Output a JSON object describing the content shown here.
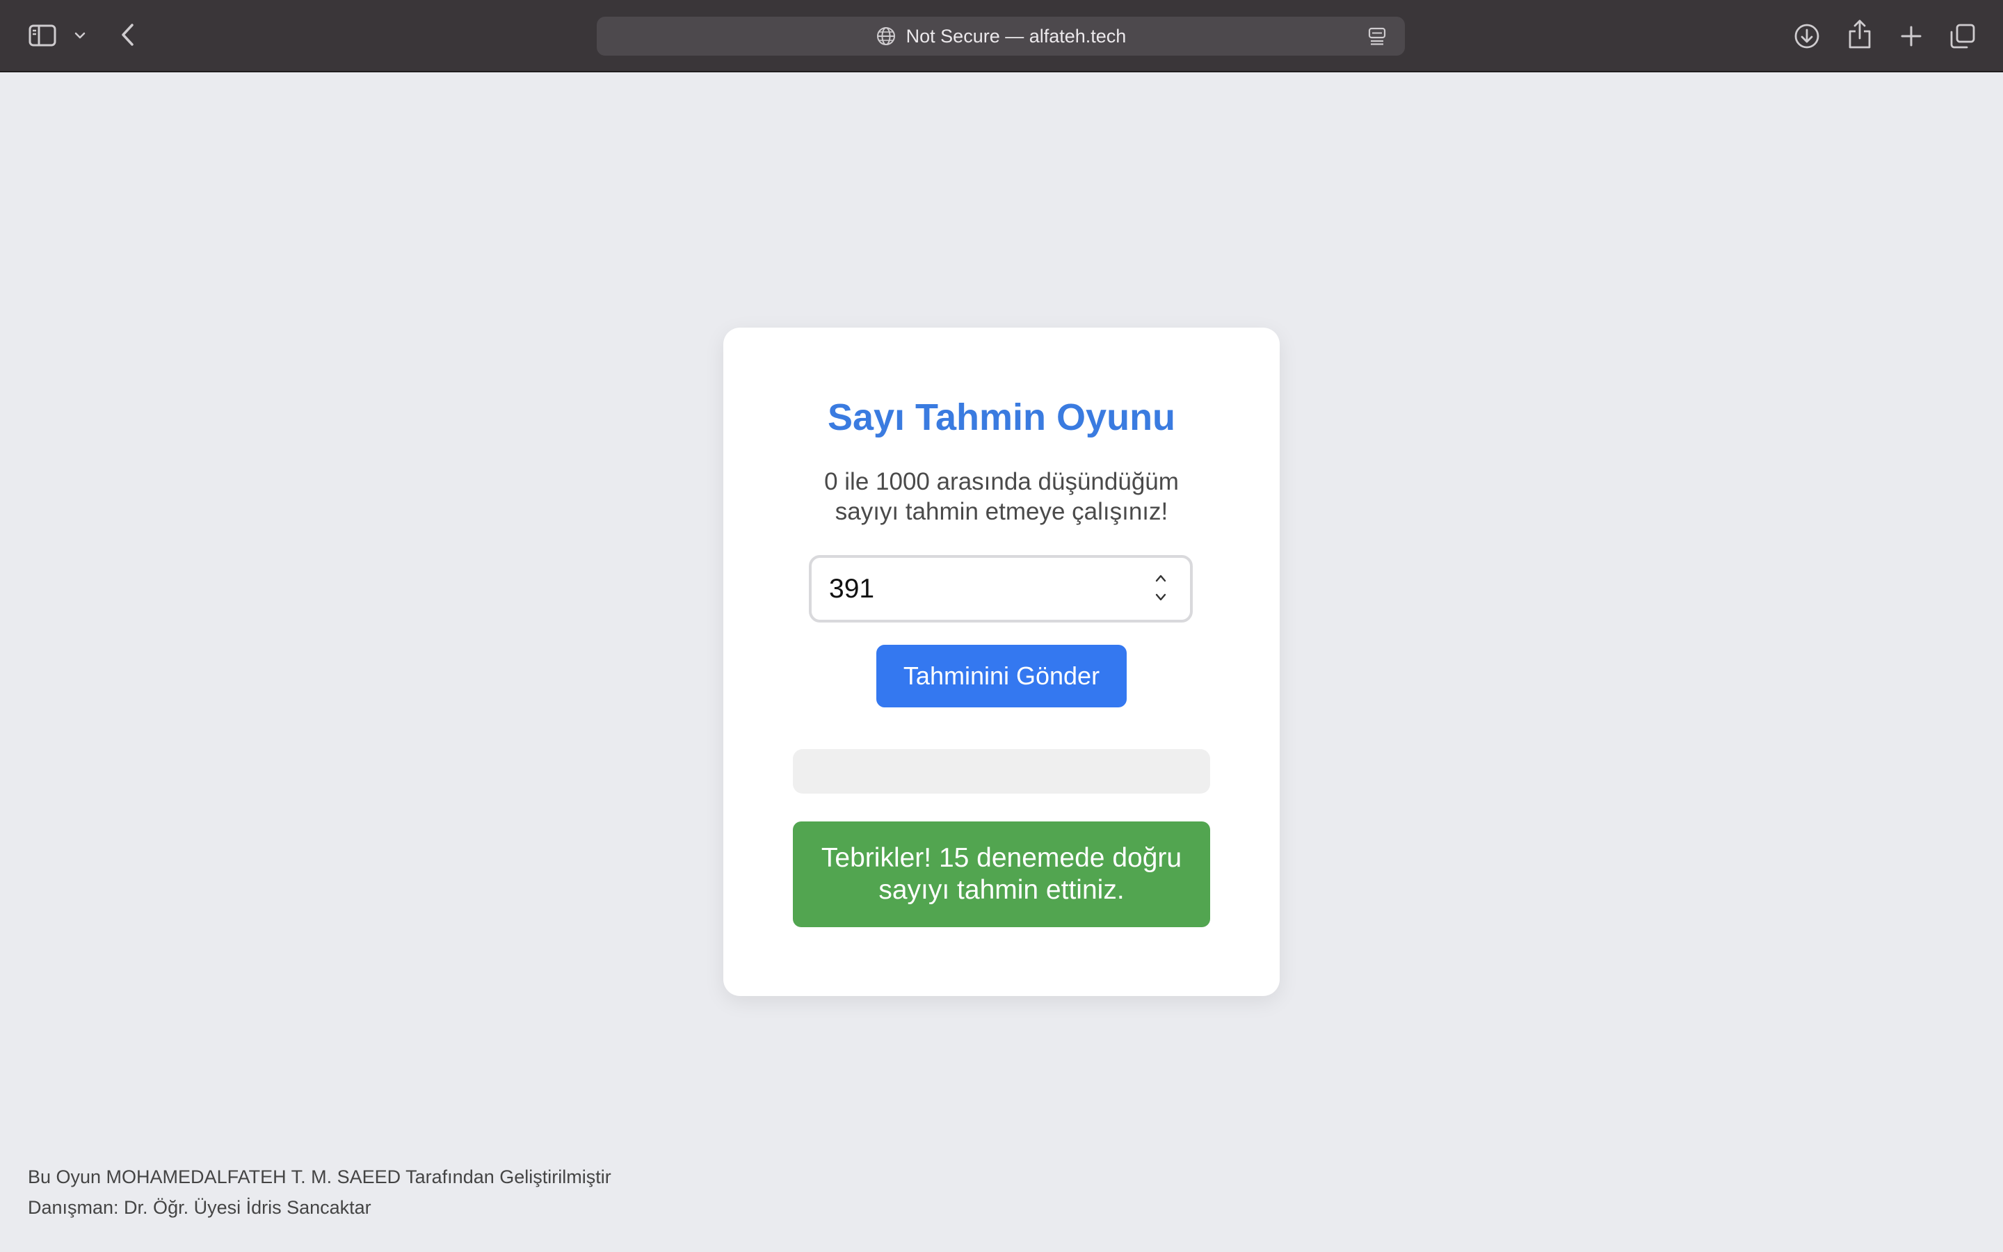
{
  "browser": {
    "address": "Not Secure — alfateh.tech",
    "icons": {
      "sidebar": "sidebar-icon",
      "chevron": "chevron-down-icon",
      "back": "chevron-left-icon",
      "globe": "globe-icon",
      "reader": "reader-icon",
      "download": "download-icon",
      "share": "share-icon",
      "new_tab": "plus-icon",
      "tabs": "tabs-overview-icon"
    }
  },
  "game": {
    "title": "Sayı Tahmin Oyunu",
    "description": "0 ile 1000 arasında düşündüğüm sayıyı tahmin etmeye çalışınız!",
    "guess_value": "391",
    "submit_label": "Tahminini Gönder",
    "hint_text": "",
    "success_message": "Tebrikler! 15 denemede doğru sayıyı tahmin ettiniz."
  },
  "footer": {
    "credit": "Bu Oyun MOHAMEDALFATEH T. M. SAEED Tarafından Geliştirilmiştir",
    "advisor": "Danışman: Dr. Öğr. Üyesi İdris Sancaktar"
  },
  "colors": {
    "page_background": "#eaebef",
    "title": "#3a7be0",
    "button": "#3478f0",
    "success": "#52a550",
    "toolbar": "#3a3639"
  }
}
